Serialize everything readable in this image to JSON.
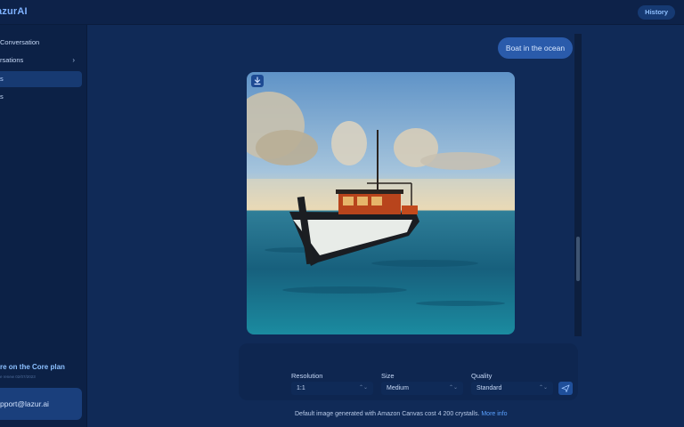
{
  "app": {
    "brand": "azurAI"
  },
  "header": {
    "history_label": "History"
  },
  "sidebar": {
    "items": [
      {
        "label": "Conversation"
      },
      {
        "label": "rsations",
        "chevron": "›"
      },
      {
        "label": "s"
      },
      {
        "label": "s"
      }
    ],
    "plan_title": "re on the Core plan",
    "plan_sub": "e renew 02/07/2023",
    "support_label": "pport@lazur.ai"
  },
  "chat": {
    "user_message": "Boat in the ocean",
    "image_icon": "download-icon"
  },
  "controls": {
    "resolution": {
      "label": "Resolution",
      "value": "1:1"
    },
    "size": {
      "label": "Size",
      "value": "Medium"
    },
    "quality": {
      "label": "Quality",
      "value": "Standard"
    },
    "send_icon": "send-icon"
  },
  "footer": {
    "text": "Default image generated with Amazon Canvas cost 4 200 crystalls.",
    "link": "More info"
  },
  "colors": {
    "background": "#102a57",
    "sidebar": "#0c2146",
    "accent": "#2a5bab",
    "link": "#5aa1ff"
  }
}
